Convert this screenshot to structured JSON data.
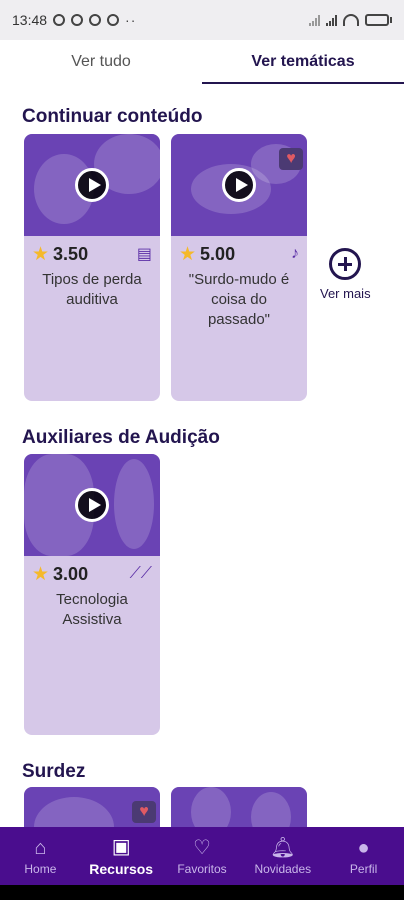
{
  "status_bar": {
    "time": "13:48",
    "battery_level": 0.6
  },
  "tabs": [
    {
      "label": "Ver tudo",
      "active": false
    },
    {
      "label": "Ver temáticas",
      "active": true
    }
  ],
  "sections": [
    {
      "title": "Continuar conteúdo",
      "cards": [
        {
          "rating": "3.50",
          "title": "Tipos de perda auditiva",
          "type_icon": "library-icon",
          "favorite": false
        },
        {
          "rating": "5.00",
          "title": "\"Surdo-mudo é coisa do passado\"",
          "type_icon": "music-note-icon",
          "favorite": true
        }
      ],
      "see_more_label": "Ver mais"
    },
    {
      "title": "Auxiliares de Audição",
      "cards": [
        {
          "rating": "3.00",
          "title": "Tecnologia Assistiva",
          "type_icon": "trending-icon",
          "favorite": false
        }
      ]
    },
    {
      "title": "Surdez",
      "cards": [
        {
          "favorite": true
        },
        {
          "favorite": false
        }
      ]
    }
  ],
  "bottom_nav": [
    {
      "label": "Home",
      "icon": "home-icon",
      "active": false
    },
    {
      "label": "Recursos",
      "icon": "resources-icon",
      "active": true
    },
    {
      "label": "Favoritos",
      "icon": "heart-icon",
      "active": false
    },
    {
      "label": "Novidades",
      "icon": "bell-icon",
      "active": false
    },
    {
      "label": "Perfil",
      "icon": "person-icon",
      "active": false
    }
  ],
  "colors": {
    "primary": "#4a0d8e",
    "heading": "#23154f",
    "card_bg": "#d6c8e8",
    "star": "#f5b92a",
    "heart": "#e05a63"
  }
}
